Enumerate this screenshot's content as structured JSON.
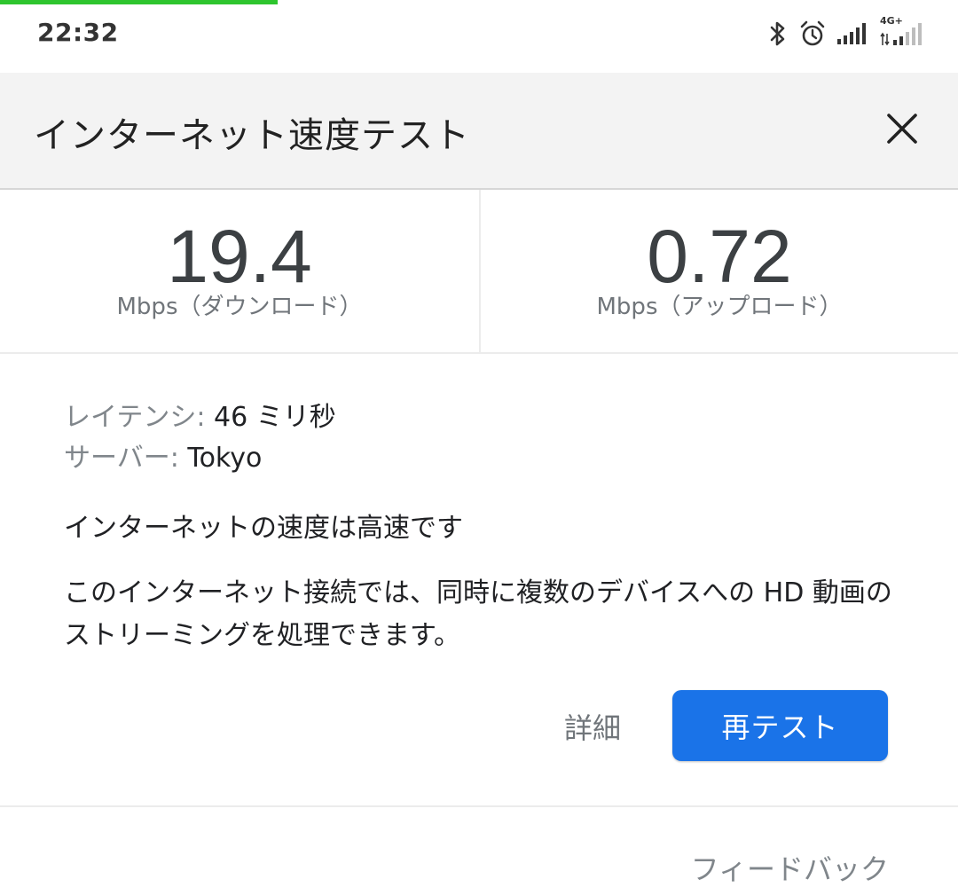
{
  "status_bar": {
    "time": "22:32",
    "network_label": "4G+",
    "icons": [
      "bluetooth-icon",
      "alarm-icon",
      "signal-icon",
      "signal-4g-icon"
    ]
  },
  "dialog": {
    "title": "インターネット速度テスト",
    "close_icon": "close-icon"
  },
  "results": {
    "download": {
      "value": "19.4",
      "unit": "Mbps（ダウンロード）"
    },
    "upload": {
      "value": "0.72",
      "unit": "Mbps（アップロード）"
    }
  },
  "details": {
    "latency_label": "レイテンシ:",
    "latency_value": " 46 ミリ秒",
    "server_label": "サーバー:",
    "server_value": " Tokyo"
  },
  "summary": {
    "headline": "インターネットの速度は高速です",
    "description": "このインターネット接続では、同時に複数のデバイスへの HD 動画のストリーミングを処理できます。"
  },
  "actions": {
    "details_label": "詳細",
    "retest_label": "再テスト",
    "feedback_label": "フィードバック"
  },
  "colors": {
    "accent": "#1a73e8",
    "progress": "#2ec52e",
    "header_bg": "#f3f3f3"
  }
}
